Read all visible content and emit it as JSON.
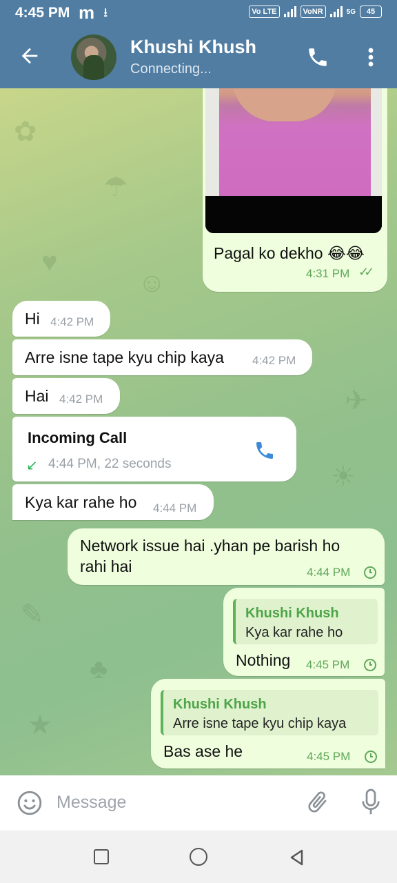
{
  "status_bar": {
    "time": "4:45 PM",
    "carrier_glyph": "m",
    "volte_tag": "Vo LTE",
    "vonr_tag": "VoNR",
    "network_5g": "5G",
    "battery": "45"
  },
  "header": {
    "contact_name": "Khushi Khush",
    "status": "Connecting..."
  },
  "messages": [
    {
      "type": "photo",
      "direction": "out",
      "text": "Pagal ko dekho 😂😂",
      "time": "4:31 PM",
      "status": "read"
    },
    {
      "direction": "in",
      "text": "Hi",
      "time": "4:42 PM"
    },
    {
      "direction": "in",
      "text": "Arre isne tape kyu chip kaya",
      "time": "4:42 PM"
    },
    {
      "direction": "in",
      "text": "Hai",
      "time": "4:42 PM"
    },
    {
      "type": "call",
      "direction": "in",
      "title": "Incoming Call",
      "detail": "4:44 PM, 22 seconds"
    },
    {
      "direction": "in",
      "text": "Kya kar rahe ho",
      "time": "4:44 PM"
    },
    {
      "direction": "out",
      "text_line1": "Network issue hai .yhan pe barish ho",
      "text_line2": "rahi hai",
      "time": "4:44 PM",
      "status": "pending"
    },
    {
      "direction": "out",
      "reply_name": "Khushi Khush",
      "reply_text": "Kya kar rahe ho",
      "text": "Nothing",
      "time": "4:45 PM",
      "status": "pending"
    },
    {
      "direction": "out",
      "reply_name": "Khushi Khush",
      "reply_text": "Arre isne tape kyu chip kaya",
      "text": "Bas ase he",
      "time": "4:45 PM",
      "status": "pending"
    }
  ],
  "input": {
    "placeholder": "Message",
    "value": ""
  },
  "colors": {
    "header_bg": "#517da2",
    "incoming_bubble": "#ffffff",
    "outgoing_bubble": "#effedd",
    "outgoing_meta": "#5fa85a",
    "call_icon": "#3d8bd8"
  },
  "icons": [
    "back-arrow-icon",
    "phone-icon",
    "more-vert-icon",
    "emoji-icon",
    "attach-icon",
    "mic-icon",
    "incoming-call-arrow-icon",
    "read-checks-icon",
    "clock-icon",
    "nav-recents-icon",
    "nav-home-icon",
    "nav-back-icon"
  ]
}
